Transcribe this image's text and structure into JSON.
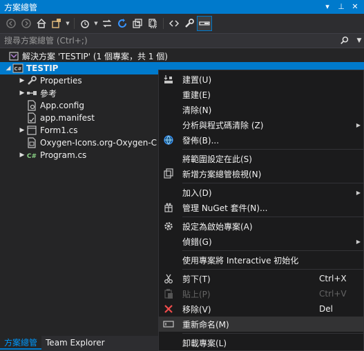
{
  "window": {
    "title": "方案總管"
  },
  "search": {
    "placeholder": "搜尋方案總管 (Ctrl+;)"
  },
  "tree": {
    "solution": "解決方案 'TESTIP' (1 個專案，共 1 個)",
    "project": "TESTIP",
    "items": [
      {
        "label": "Properties"
      },
      {
        "label": "參考"
      },
      {
        "label": "App.config"
      },
      {
        "label": "app.manifest"
      },
      {
        "label": "Form1.cs"
      },
      {
        "label": "Oxygen-Icons.org-Oxygen-C"
      },
      {
        "label": "Program.cs"
      }
    ]
  },
  "bottom_tabs": [
    {
      "label": "方案總管"
    },
    {
      "label": "Team Explorer"
    }
  ],
  "context_menu": {
    "items": [
      {
        "label": "建置(U)"
      },
      {
        "label": "重建(E)"
      },
      {
        "label": "清除(N)"
      },
      {
        "label": "分析與程式碼清除 (Z)"
      },
      {
        "label": "發佈(B)..."
      },
      {
        "label": "將範圍設定在此(S)"
      },
      {
        "label": "新增方案總管檢視(N)"
      },
      {
        "label": "加入(D)"
      },
      {
        "label": "管理 NuGet 套件(N)..."
      },
      {
        "label": "設定為啟始專案(A)"
      },
      {
        "label": "偵錯(G)"
      },
      {
        "label": "使用專案將 Interactive 初始化"
      },
      {
        "label": "剪下(T)",
        "shortcut": "Ctrl+X"
      },
      {
        "label": "貼上(P)",
        "shortcut": "Ctrl+V"
      },
      {
        "label": "移除(V)",
        "shortcut": "Del"
      },
      {
        "label": "重新命名(M)"
      },
      {
        "label": "卸載專案(L)"
      }
    ]
  },
  "colors": {
    "accent": "#007acc",
    "background": "#252526",
    "menu_bg": "#1b1b1c"
  }
}
